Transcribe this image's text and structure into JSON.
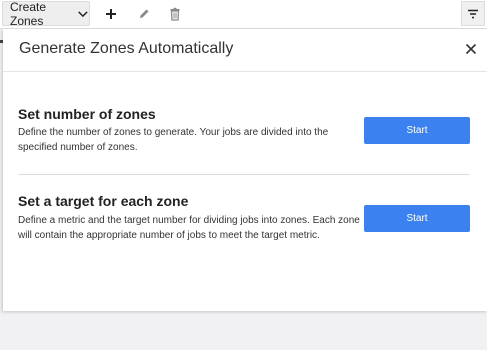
{
  "toolbar": {
    "create_zones_label": "Create Zones",
    "icons": [
      "add-icon",
      "edit-icon",
      "delete-icon",
      "filter-icon"
    ]
  },
  "dialog": {
    "title": "Generate Zones Automatically",
    "close_icon": "close-icon",
    "options": [
      {
        "title": "Set number of zones",
        "description": "Define the number of zones to generate. Your jobs are divided into the specified number of zones.",
        "button_label": "Start"
      },
      {
        "title": "Set a target for each zone",
        "description": "Define a metric and the target number for dividing jobs into zones. Each zone will contain the appropriate number of jobs to meet the target metric.",
        "button_label": "Start"
      }
    ]
  },
  "colors": {
    "accent": "#3b82f0",
    "background": "#f1f1f3"
  }
}
